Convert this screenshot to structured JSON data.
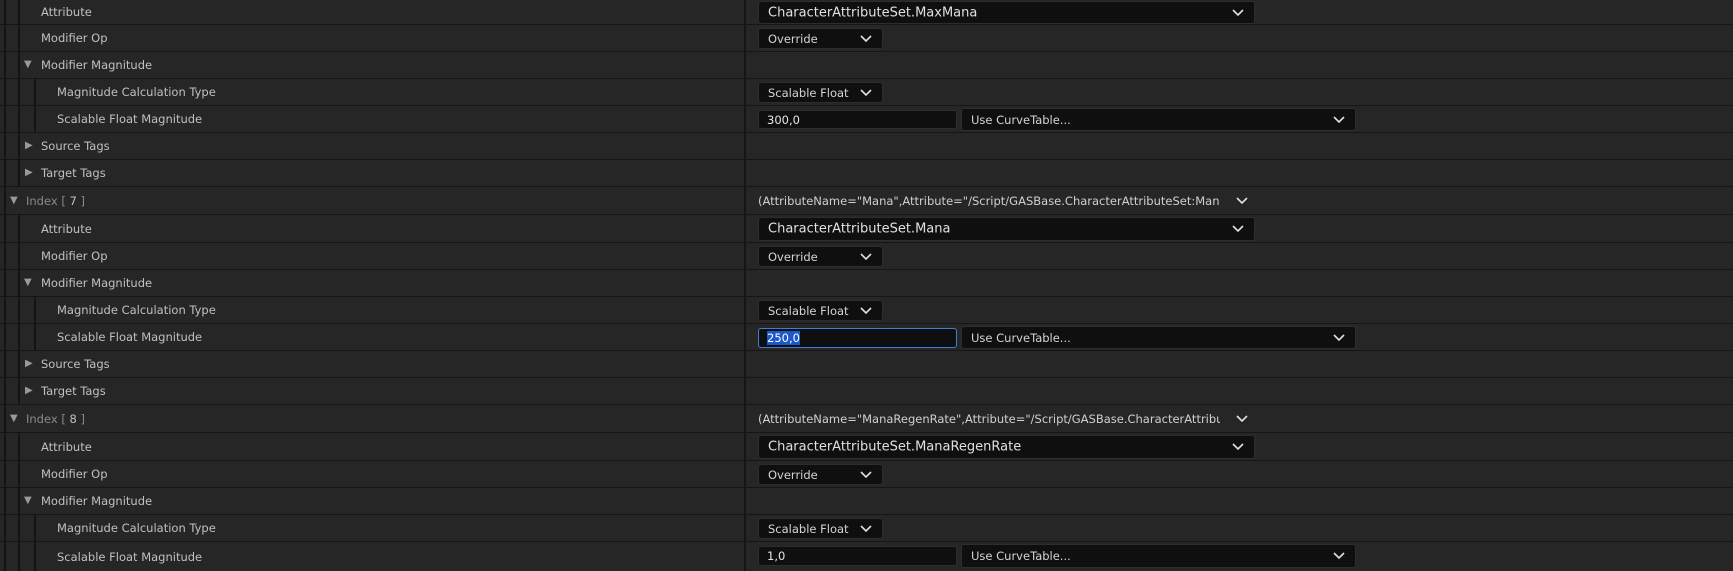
{
  "labels": {
    "attribute": "Attribute",
    "modifier_op": "Modifier Op",
    "modifier_magnitude": "Modifier Magnitude",
    "magnitude_calculation_type": "Magnitude Calculation Type",
    "scalable_float_magnitude": "Scalable Float Magnitude",
    "source_tags": "Source Tags",
    "target_tags": "Target Tags",
    "index_prefix": "Index [",
    "index_suffix": "]"
  },
  "modifiers": [
    {
      "attribute": "CharacterAttributeSet.MaxMana",
      "modifier_op": "Override",
      "calc_type": "Scalable Float",
      "magnitude": "300,0",
      "curve_table": "Use CurveTable..."
    },
    {
      "index": "7",
      "struct_value": "(AttributeName=\"Mana\",Attribute=\"/Script/GASBase.CharacterAttributeSet:Mana\",Attribute(",
      "attribute": "CharacterAttributeSet.Mana",
      "modifier_op": "Override",
      "calc_type": "Scalable Float",
      "magnitude": "250,0",
      "curve_table": "Use CurveTable..."
    },
    {
      "index": "8",
      "struct_value": "(AttributeName=\"ManaRegenRate\",Attribute=\"/Script/GASBase.CharacterAttributeSet:Mana",
      "attribute": "CharacterAttributeSet.ManaRegenRate",
      "modifier_op": "Override",
      "calc_type": "Scalable Float",
      "magnitude": "1,0",
      "curve_table": "Use CurveTable..."
    }
  ],
  "icons": {
    "expanded": "triangle-down-icon",
    "collapsed": "triangle-right-icon",
    "dropdown": "chevron-down-icon"
  },
  "colors": {
    "row_bg": "#262626",
    "field_bg": "#0f0f0f",
    "selection": "#1b57c8",
    "focus_border": "#3b7fd6"
  }
}
